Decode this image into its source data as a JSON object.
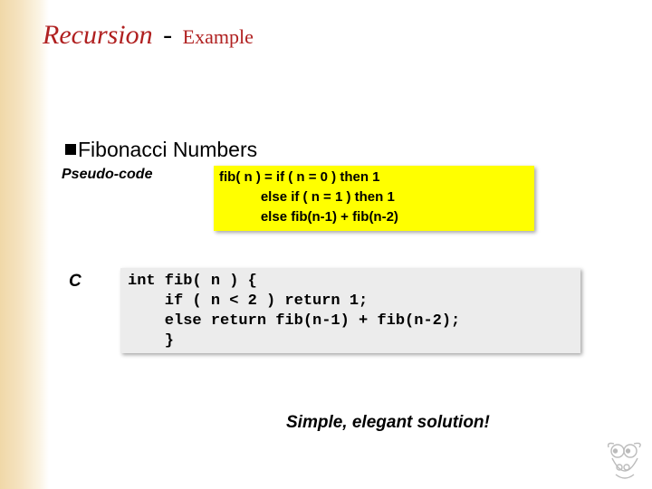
{
  "title": {
    "word1": "Recursion",
    "dash": "-",
    "word2": "Example"
  },
  "bullet": {
    "text": "Fibonacci Numbers"
  },
  "pseudo": {
    "label": "Pseudo-code",
    "code": "fib( n ) = if ( n = 0 ) then 1\n           else if ( n = 1 ) then 1\n           else fib(n-1) + fib(n-2)"
  },
  "c": {
    "label": "C",
    "code": "int fib( n ) {\n    if ( n < 2 ) return 1;\n    else return fib(n-1) + fib(n-2);\n    }"
  },
  "tagline": "Simple, elegant solution!"
}
